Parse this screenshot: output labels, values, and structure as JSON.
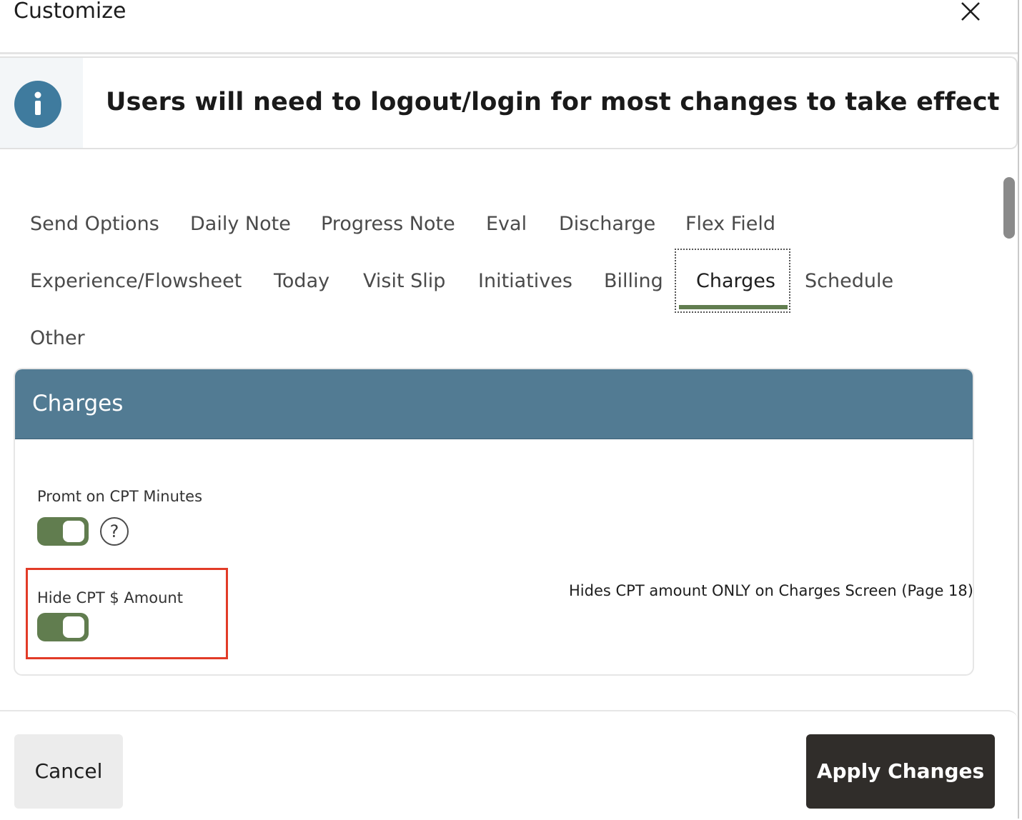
{
  "dialog": {
    "title": "Customize"
  },
  "banner": {
    "message": "Users will need to logout/login for most changes to take effect",
    "icon": "info-icon"
  },
  "tabs": [
    {
      "label": "Send Options"
    },
    {
      "label": "Daily Note"
    },
    {
      "label": "Progress Note"
    },
    {
      "label": "Eval"
    },
    {
      "label": "Discharge"
    },
    {
      "label": "Flex Field"
    },
    {
      "label": "Experience/Flowsheet"
    },
    {
      "label": "Today"
    },
    {
      "label": "Visit Slip"
    },
    {
      "label": "Initiatives"
    },
    {
      "label": "Billing"
    },
    {
      "label": "Charges",
      "active": true
    },
    {
      "label": "Schedule"
    },
    {
      "label": "Other"
    }
  ],
  "panel": {
    "title": "Charges",
    "settings": [
      {
        "label": "Promt on CPT Minutes",
        "enabled": true,
        "help_glyph": "?"
      },
      {
        "label": "Hide CPT $ Amount",
        "enabled": true,
        "description": "Hides CPT amount ONLY on Charges Screen (Page 18)"
      }
    ]
  },
  "footer": {
    "cancel_label": "Cancel",
    "apply_label": "Apply Changes"
  },
  "colors": {
    "accent_green": "#617d4f",
    "panel_header": "#527b93",
    "info_blue": "#3f7b9e",
    "highlight_red": "#e23b27",
    "apply_button": "#302d2a"
  }
}
